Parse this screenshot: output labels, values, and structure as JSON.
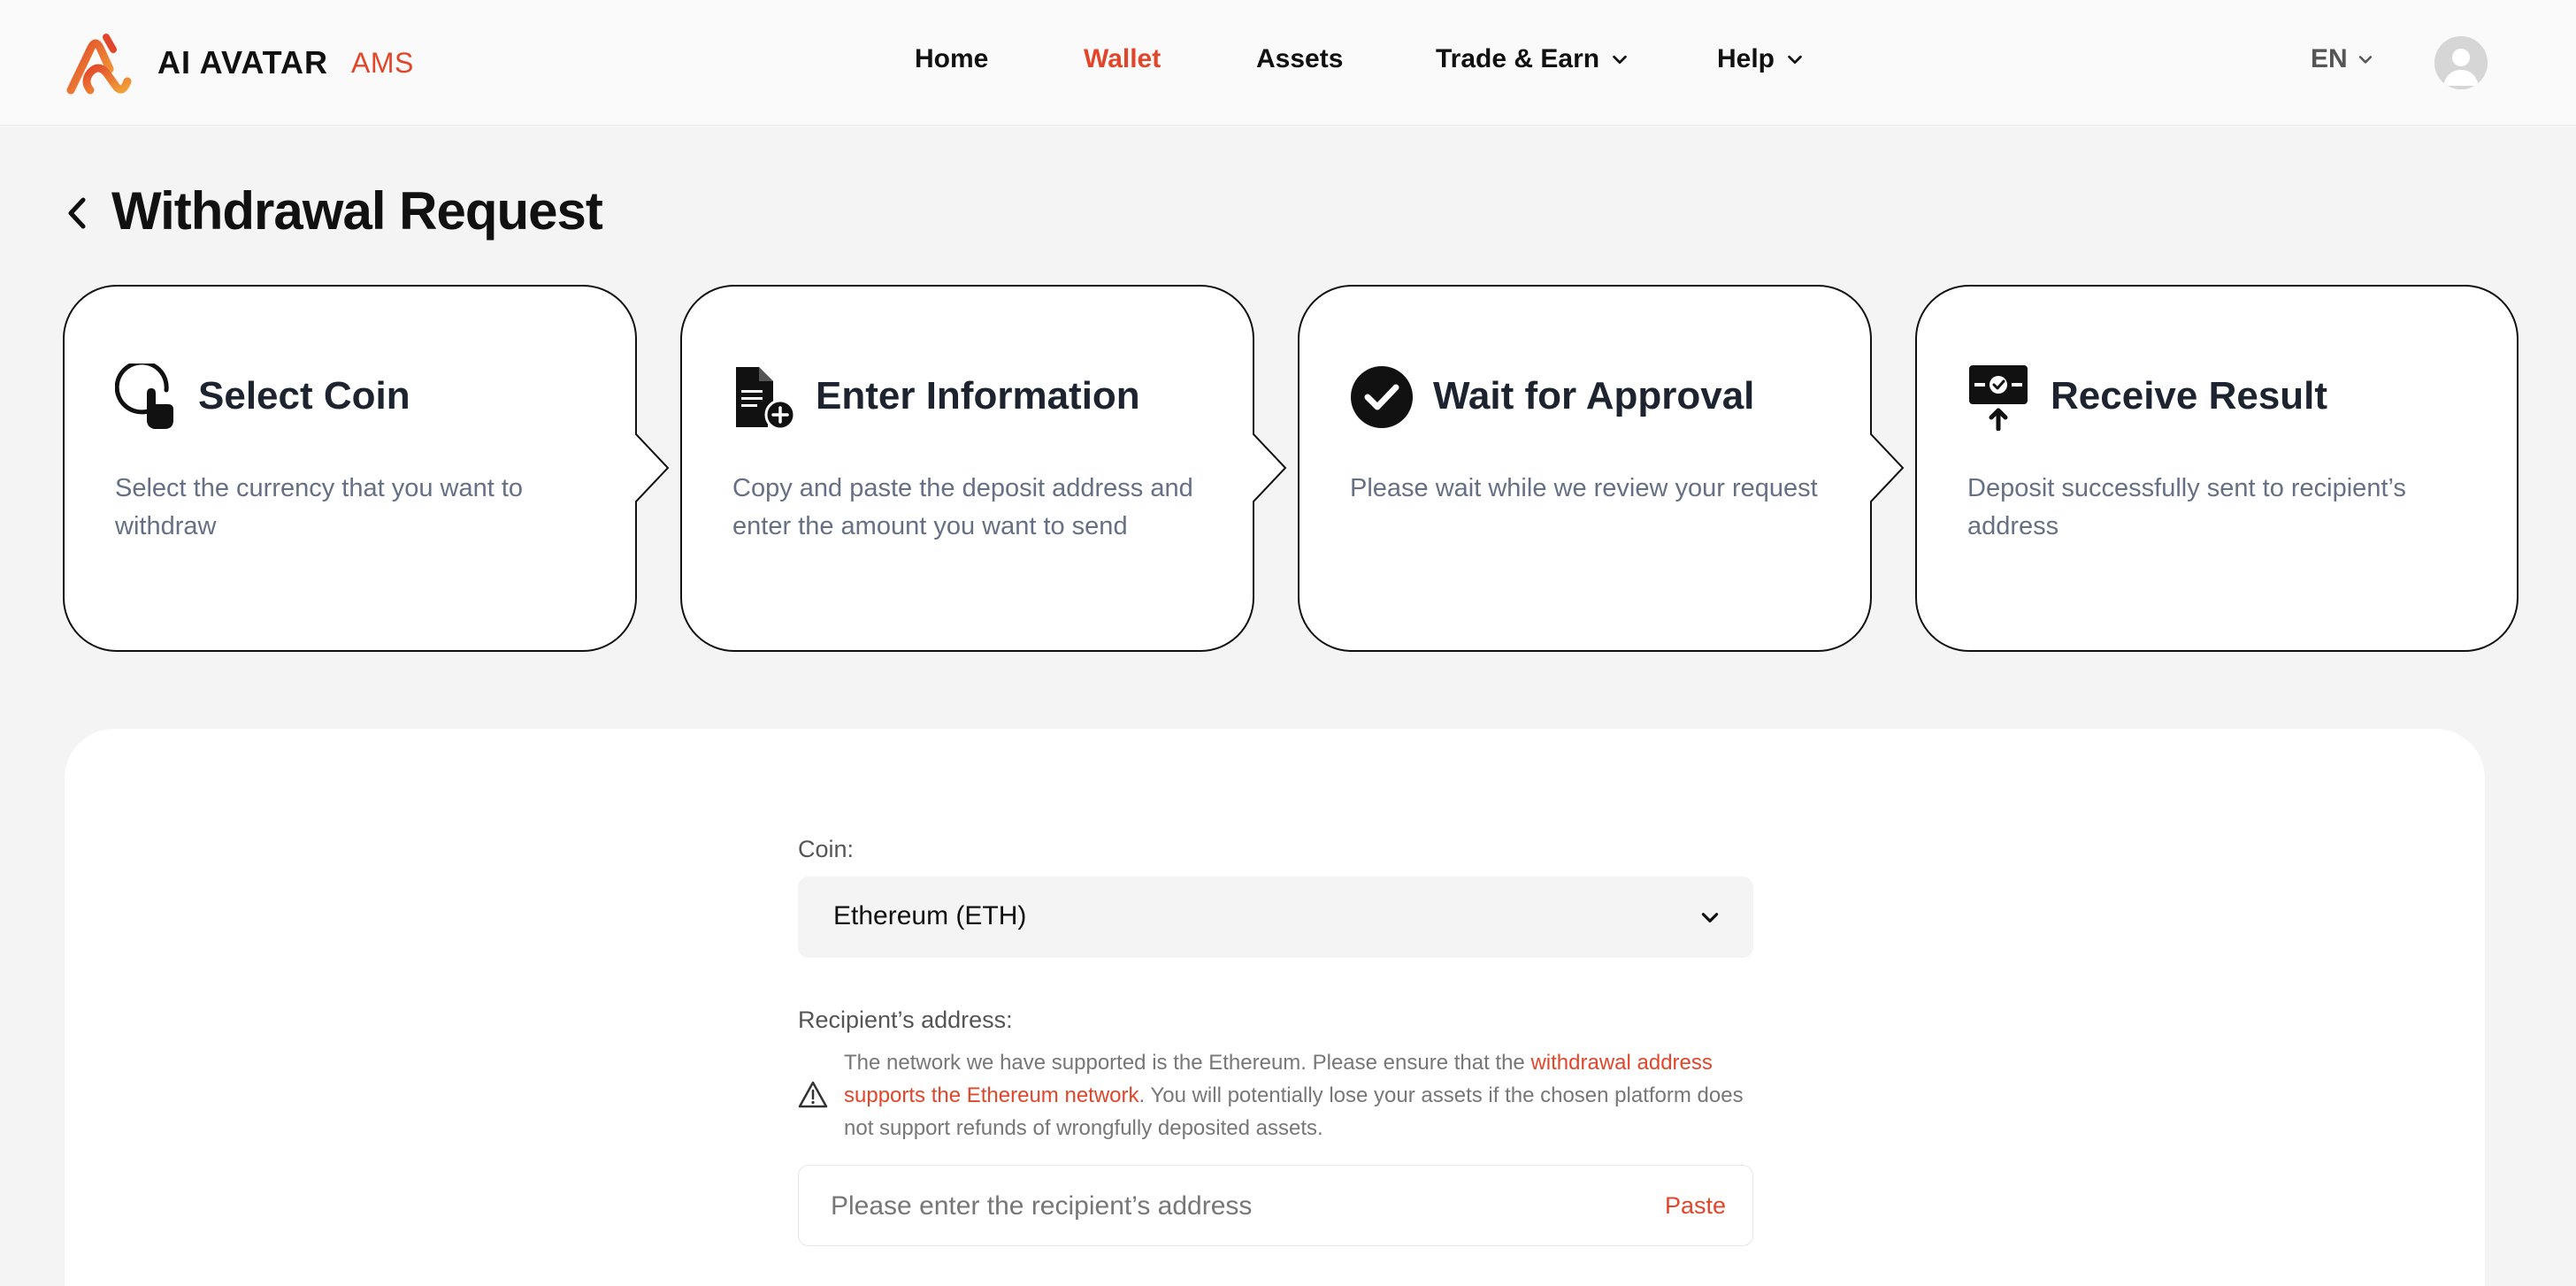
{
  "header": {
    "brand": "AI AVATAR",
    "brand_sub": "AMS",
    "nav": {
      "home": "Home",
      "wallet": "Wallet",
      "assets": "Assets",
      "trade_earn": "Trade & Earn",
      "help": "Help"
    },
    "language": "EN"
  },
  "page": {
    "title": "Withdrawal Request"
  },
  "steps": [
    {
      "title": "Select Coin",
      "description": "Select the currency that you want to withdraw",
      "icon": "pointer-click-icon"
    },
    {
      "title": "Enter Information",
      "description": "Copy and paste the deposit address and enter the amount you want to send",
      "icon": "document-add-icon"
    },
    {
      "title": "Wait for Approval",
      "description": "Please wait while we review your request",
      "icon": "check-circle-icon"
    },
    {
      "title": "Receive Result",
      "description": "Deposit successfully sent to recipient’s address",
      "icon": "ticket-upload-icon"
    }
  ],
  "form": {
    "coin_label": "Coin:",
    "coin_value": "Ethereum (ETH)",
    "address_label": "Recipient’s address:",
    "warning": {
      "part1": "The network we have supported is the Ethereum. Please ensure that the ",
      "highlight": "withdrawal address supports the Ethereum network",
      "part2": ". You will potentially lose your assets if the chosen platform does not support refunds of wrongfully deposited assets."
    },
    "address_placeholder": "Please enter the recipient’s address",
    "paste_label": "Paste"
  },
  "colors": {
    "accent": "#e2462a",
    "text_primary": "#111111",
    "text_muted": "#667085",
    "background": "#f4f4f4",
    "panel": "#ffffff"
  }
}
